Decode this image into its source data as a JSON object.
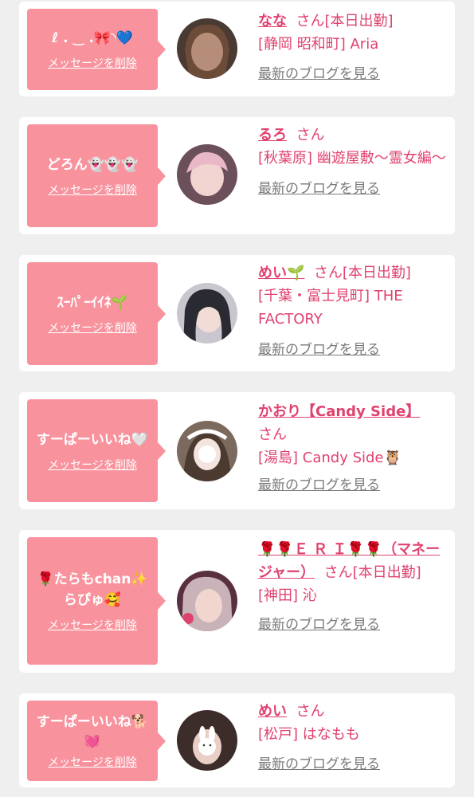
{
  "entries": [
    {
      "message": "ℓ . ‿ .🎀◝💙",
      "delete_label": "メッセージを削除",
      "name": "なな",
      "honorific": "さん",
      "status": "[本日出勤]",
      "shop": "[静岡 昭和町] Aria",
      "blog_label": "最新のブログを見る"
    },
    {
      "message": "どろん👻👻👻",
      "delete_label": "メッセージを削除",
      "name": "るろ",
      "honorific": "さん",
      "status": "",
      "shop": "[秋葉原] 幽遊屋敷～霊女編～",
      "blog_label": "最新のブログを見る"
    },
    {
      "message": "ｽｰﾊﾟｰｲｲﾈ🌱",
      "delete_label": "メッセージを削除",
      "name": "めい🌱",
      "honorific": "さん",
      "status": "[本日出勤]",
      "shop": "[千葉・富士見町] THE FACTORY",
      "blog_label": "最新のブログを見る"
    },
    {
      "message": "すーぱーいいね🤍",
      "delete_label": "メッセージを削除",
      "name": "かおり【Candy Side】",
      "honorific": "さん",
      "status": "",
      "shop": "[湯島] Candy Side🦉",
      "blog_label": "最新のブログを見る"
    },
    {
      "message": "🌹たらもchan✨らぴゅ🥰",
      "delete_label": "メッセージを削除",
      "name": "🌹🌹Ｅ Ｒ Ｉ🌹🌹（マネージャー）",
      "honorific": "さん",
      "status": "[本日出勤]",
      "shop": "[神田] 沁",
      "blog_label": "最新のブログを見る"
    },
    {
      "message": "すーぱーいいね🐕💓",
      "delete_label": "メッセージを削除",
      "name": "めい",
      "honorific": "さん",
      "status": "",
      "shop": "[松戸] はなもも",
      "blog_label": "最新のブログを見る"
    }
  ],
  "colors": {
    "accent": "#e0426e",
    "bubble": "#f8939e",
    "background": "#efefef"
  }
}
